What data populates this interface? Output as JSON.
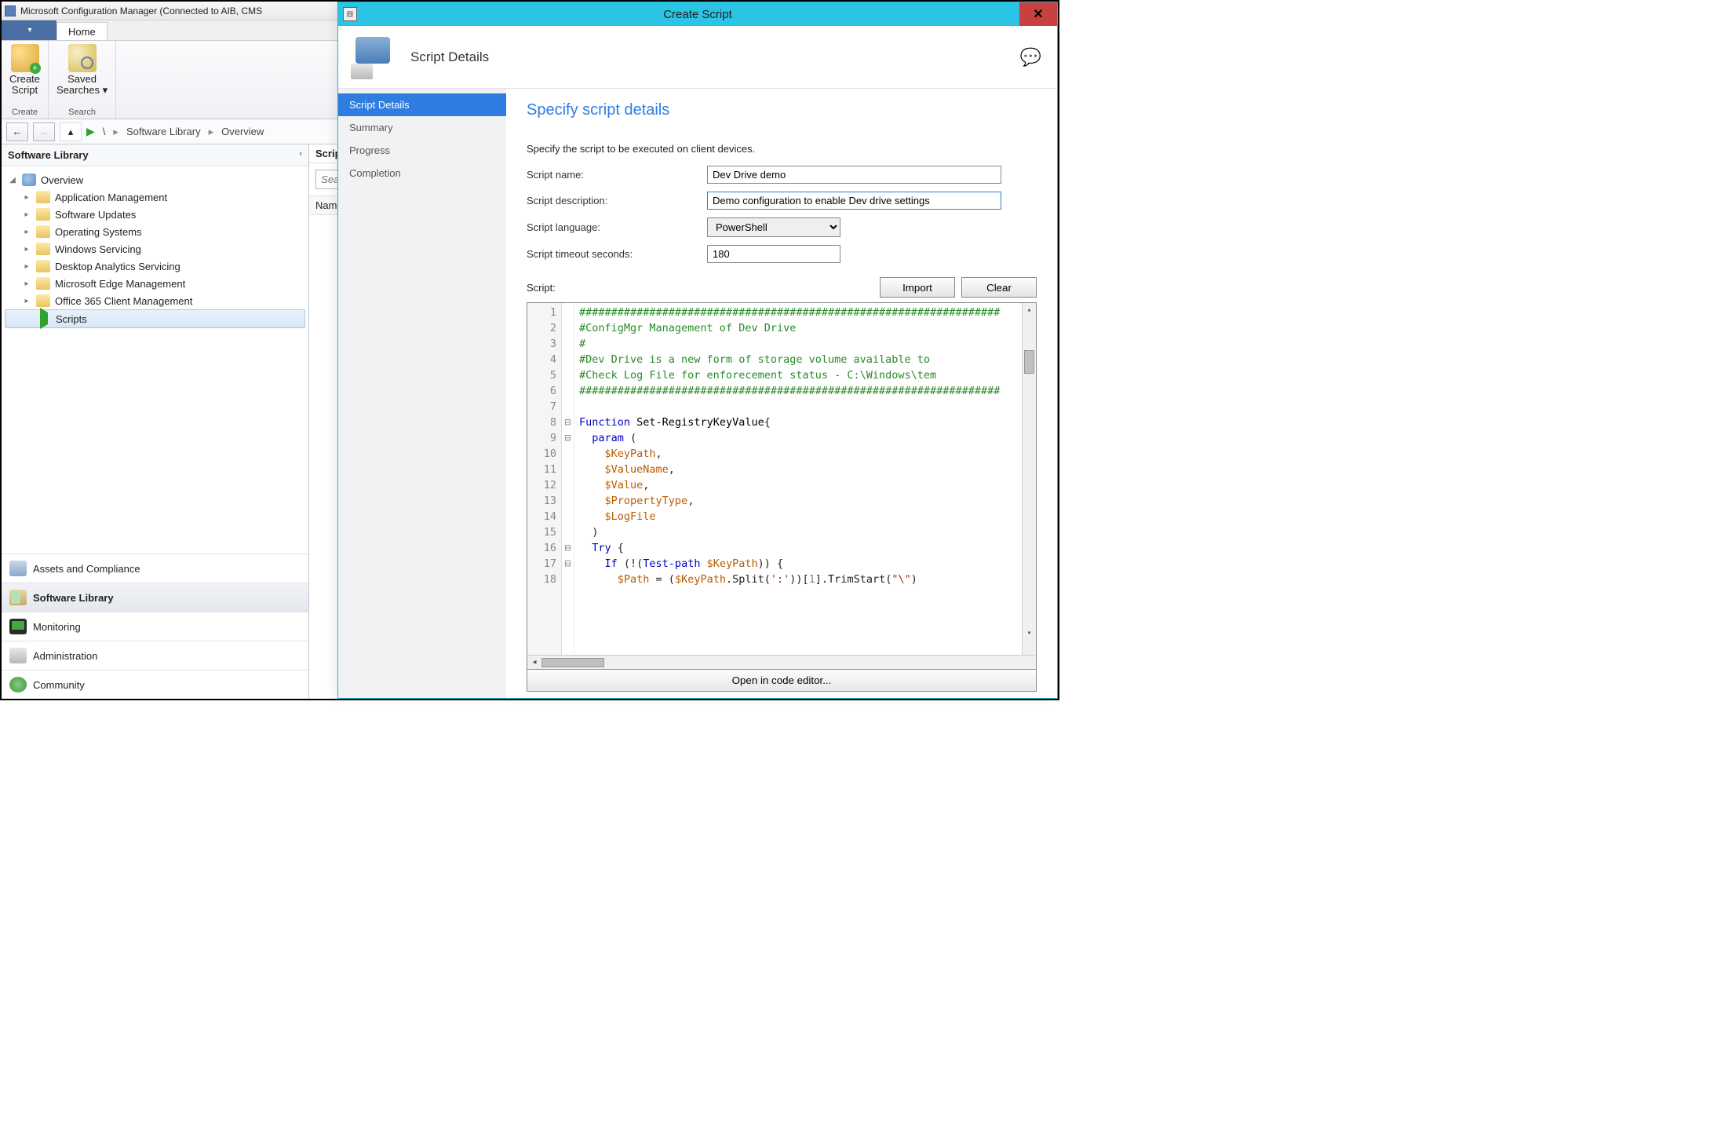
{
  "window": {
    "title": "Microsoft Configuration Manager (Connected to AIB, CMS"
  },
  "ribbon": {
    "home_tab": "Home",
    "create_script": "Create\nScript",
    "create_group": "Create",
    "saved_searches": "Saved\nSearches ▾",
    "search_group": "Search"
  },
  "breadcrumb": {
    "root": "\\",
    "lib": "Software Library",
    "overview": "Overview"
  },
  "tree": {
    "header": "Software Library",
    "overview": "Overview",
    "items": [
      "Application Management",
      "Software Updates",
      "Operating Systems",
      "Windows Servicing",
      "Desktop Analytics Servicing",
      "Microsoft Edge Management",
      "Office 365 Client Management"
    ],
    "scripts": "Scripts"
  },
  "content": {
    "header": "Scrip",
    "search_placeholder": "Sea",
    "grid_col": "Nam"
  },
  "navstack": {
    "assets": "Assets and Compliance",
    "swlib": "Software Library",
    "monitoring": "Monitoring",
    "admin": "Administration",
    "community": "Community"
  },
  "dialog": {
    "title": "Create Script",
    "header": "Script Details",
    "steps": [
      "Script Details",
      "Summary",
      "Progress",
      "Completion"
    ],
    "page_title": "Specify script details",
    "instruction": "Specify the script to be executed on client devices.",
    "labels": {
      "name": "Script name:",
      "desc": "Script description:",
      "lang": "Script language:",
      "timeout": "Script timeout seconds:",
      "script": "Script:"
    },
    "values": {
      "name": "Dev Drive demo",
      "desc": "Demo configuration to enable Dev drive settings",
      "lang": "PowerShell",
      "timeout": "180"
    },
    "buttons": {
      "import": "Import",
      "clear": "Clear",
      "open_editor": "Open in code editor..."
    },
    "code_lines": [
      {
        "n": 1,
        "t": "cmt",
        "s": "##################################################################"
      },
      {
        "n": 2,
        "t": "cmt",
        "s": "#ConfigMgr Management of Dev Drive"
      },
      {
        "n": 3,
        "t": "cmt",
        "s": "#"
      },
      {
        "n": 4,
        "t": "cmt",
        "s": "#Dev Drive is a new form of storage volume available to "
      },
      {
        "n": 5,
        "t": "cmt",
        "s": "#Check Log File for enforecement status - C:\\Windows\\tem"
      },
      {
        "n": 6,
        "t": "cmt",
        "s": "##################################################################"
      },
      {
        "n": 7,
        "t": "",
        "s": ""
      },
      {
        "n": 8,
        "t": "fn",
        "s": "Function Set-RegistryKeyValue{",
        "fold": "-"
      },
      {
        "n": 9,
        "t": "kw",
        "s": "  param (",
        "fold": "-"
      },
      {
        "n": 10,
        "t": "var",
        "s": "    $KeyPath,"
      },
      {
        "n": 11,
        "t": "var",
        "s": "    $ValueName,"
      },
      {
        "n": 12,
        "t": "var",
        "s": "    $Value,"
      },
      {
        "n": 13,
        "t": "var",
        "s": "    $PropertyType,"
      },
      {
        "n": 14,
        "t": "var",
        "s": "    $LogFile"
      },
      {
        "n": 15,
        "t": "",
        "s": "  )"
      },
      {
        "n": 16,
        "t": "kw",
        "s": "  Try {",
        "fold": "-"
      },
      {
        "n": 17,
        "t": "mix",
        "s": "    If (!(Test-path $KeyPath)) {",
        "fold": "-"
      },
      {
        "n": 18,
        "t": "mix2",
        "s": "      $Path = ($KeyPath.Split(':'))[1].TrimStart(\"\\\")"
      }
    ]
  }
}
